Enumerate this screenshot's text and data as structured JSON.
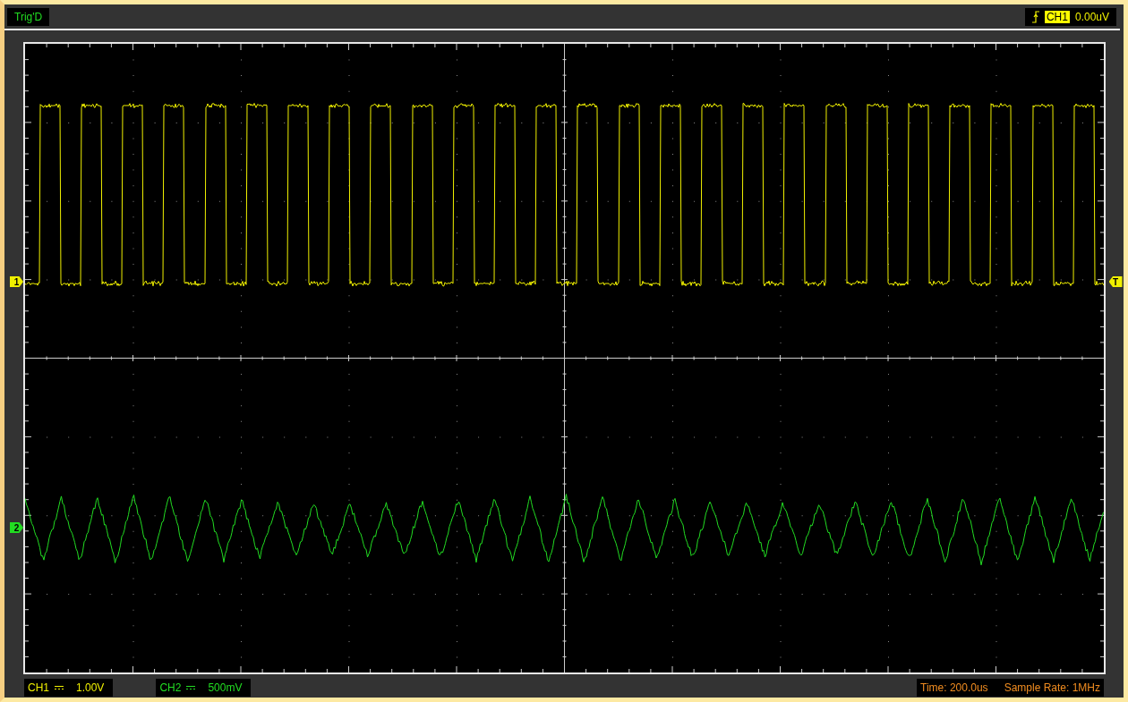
{
  "trigger_status": "Trig'D",
  "trigger": {
    "channel": "CH1",
    "level": "0.00uV",
    "marker": "T"
  },
  "channels": [
    {
      "label": "CH1",
      "marker": "1",
      "scale": "1.00V",
      "color": "#f0f000",
      "kind": "square"
    },
    {
      "label": "CH2",
      "marker": "2",
      "scale": "500mV",
      "color": "#22dd22",
      "kind": "triangle"
    }
  ],
  "time": "Time: 200.0us",
  "sample_rate": "Sample Rate: 1MHz"
}
